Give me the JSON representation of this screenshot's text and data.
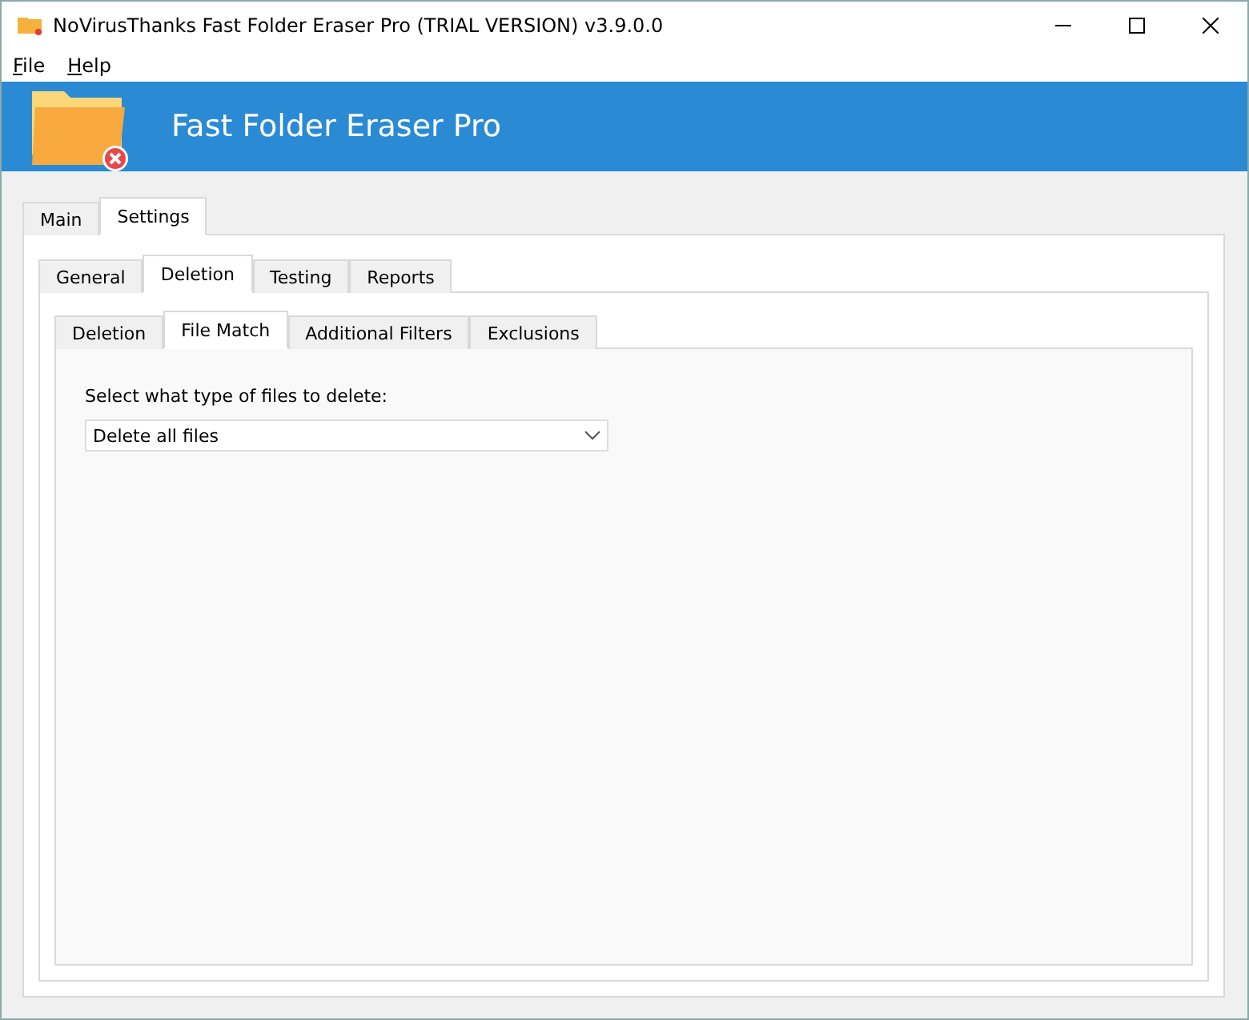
{
  "window": {
    "title": "NoVirusThanks Fast Folder Eraser Pro (TRIAL VERSION) v3.9.0.0"
  },
  "menu": [
    "File",
    "Help"
  ],
  "banner": {
    "title": "Fast Folder Eraser Pro"
  },
  "tabs": [
    {
      "label": "Main",
      "selected": false
    },
    {
      "label": "Settings",
      "selected": true
    }
  ],
  "settings_tabs": [
    {
      "label": "General",
      "selected": false
    },
    {
      "label": "Deletion",
      "selected": true
    },
    {
      "label": "Testing",
      "selected": false
    },
    {
      "label": "Reports",
      "selected": false
    }
  ],
  "deletion_tabs": [
    {
      "label": "Deletion",
      "selected": false
    },
    {
      "label": "File Match",
      "selected": true
    },
    {
      "label": "Additional Filters",
      "selected": false
    },
    {
      "label": "Exclusions",
      "selected": false
    }
  ],
  "file_match": {
    "label": "Select what type of files to delete:",
    "value": "Delete all files"
  }
}
